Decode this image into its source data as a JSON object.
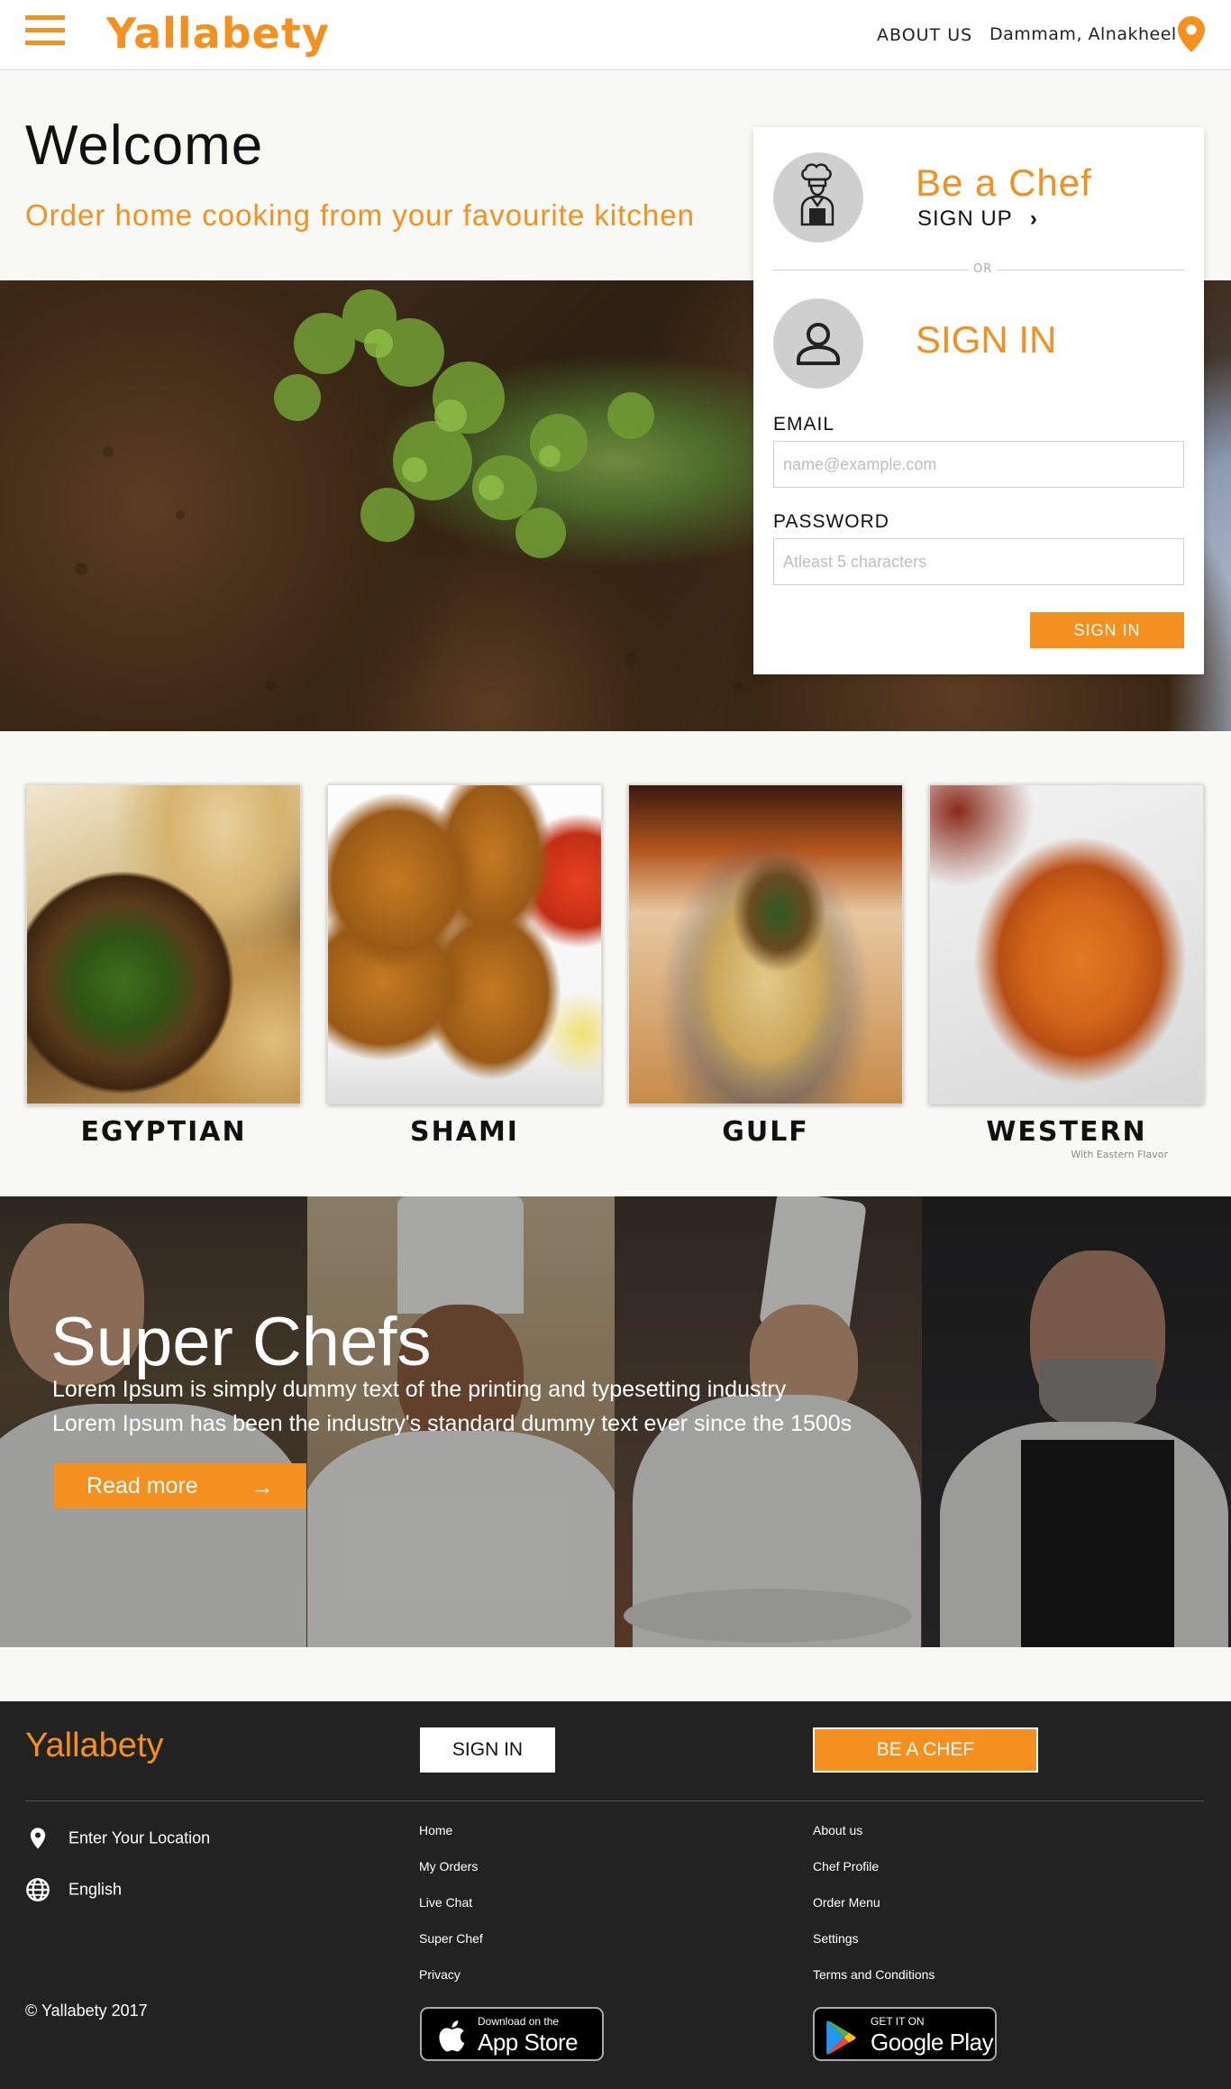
{
  "header": {
    "logo": "Yallabety",
    "about_label": "ABOUT US",
    "location_label": "Dammam, Alnakheel"
  },
  "hero": {
    "welcome": "Welcome",
    "tagline": "Order home cooking from your favourite kitchen"
  },
  "login_card": {
    "chef_title": "Be a Chef",
    "signup_label": "SIGN UP",
    "or_label": "OR",
    "signin_title": "SIGN IN",
    "email_label": "EMAIL",
    "email_placeholder": "name@example.com",
    "password_label": "PASSWORD",
    "password_placeholder": "Atleast 5 characters",
    "signin_button": "SIGN IN"
  },
  "cuisines": [
    {
      "name": "EGYPTIAN",
      "subtitle": ""
    },
    {
      "name": "SHAMI",
      "subtitle": ""
    },
    {
      "name": "GULF",
      "subtitle": ""
    },
    {
      "name": "WESTERN",
      "subtitle": "With Eastern Flavor"
    }
  ],
  "super_chefs": {
    "title": "Super Chefs",
    "line1": "Lorem Ipsum is simply dummy text of the printing and typesetting industry",
    "line2": "Lorem Ipsum has been the industry's standard dummy text ever since the 1500s",
    "read_more": "Read more"
  },
  "footer": {
    "logo": "Yallabety",
    "signin_button": "SIGN IN",
    "chef_button": "BE A CHEF",
    "location": "Enter Your Location",
    "language": "English",
    "links_col1": [
      "Home",
      "My Orders",
      "Live Chat",
      "Super Chef",
      "Privacy"
    ],
    "links_col2": [
      "About us",
      "Chef Profile",
      "Order Menu",
      "Settings",
      "Terms and Conditions"
    ],
    "copyright": "© Yallabety 2017",
    "appstore_small": "Download on the",
    "appstore_big": "App Store",
    "googleplay_small": "GET IT ON",
    "googleplay_big": "Google Play"
  },
  "colors": {
    "accent": "#f39020",
    "footer_bg": "#222222"
  },
  "icons": [
    "hamburger-menu-icon",
    "location-pin-icon",
    "chef-hat-icon",
    "user-icon",
    "chevron-right-icon",
    "arrow-right-icon",
    "globe-icon",
    "apple-icon",
    "google-play-icon"
  ]
}
